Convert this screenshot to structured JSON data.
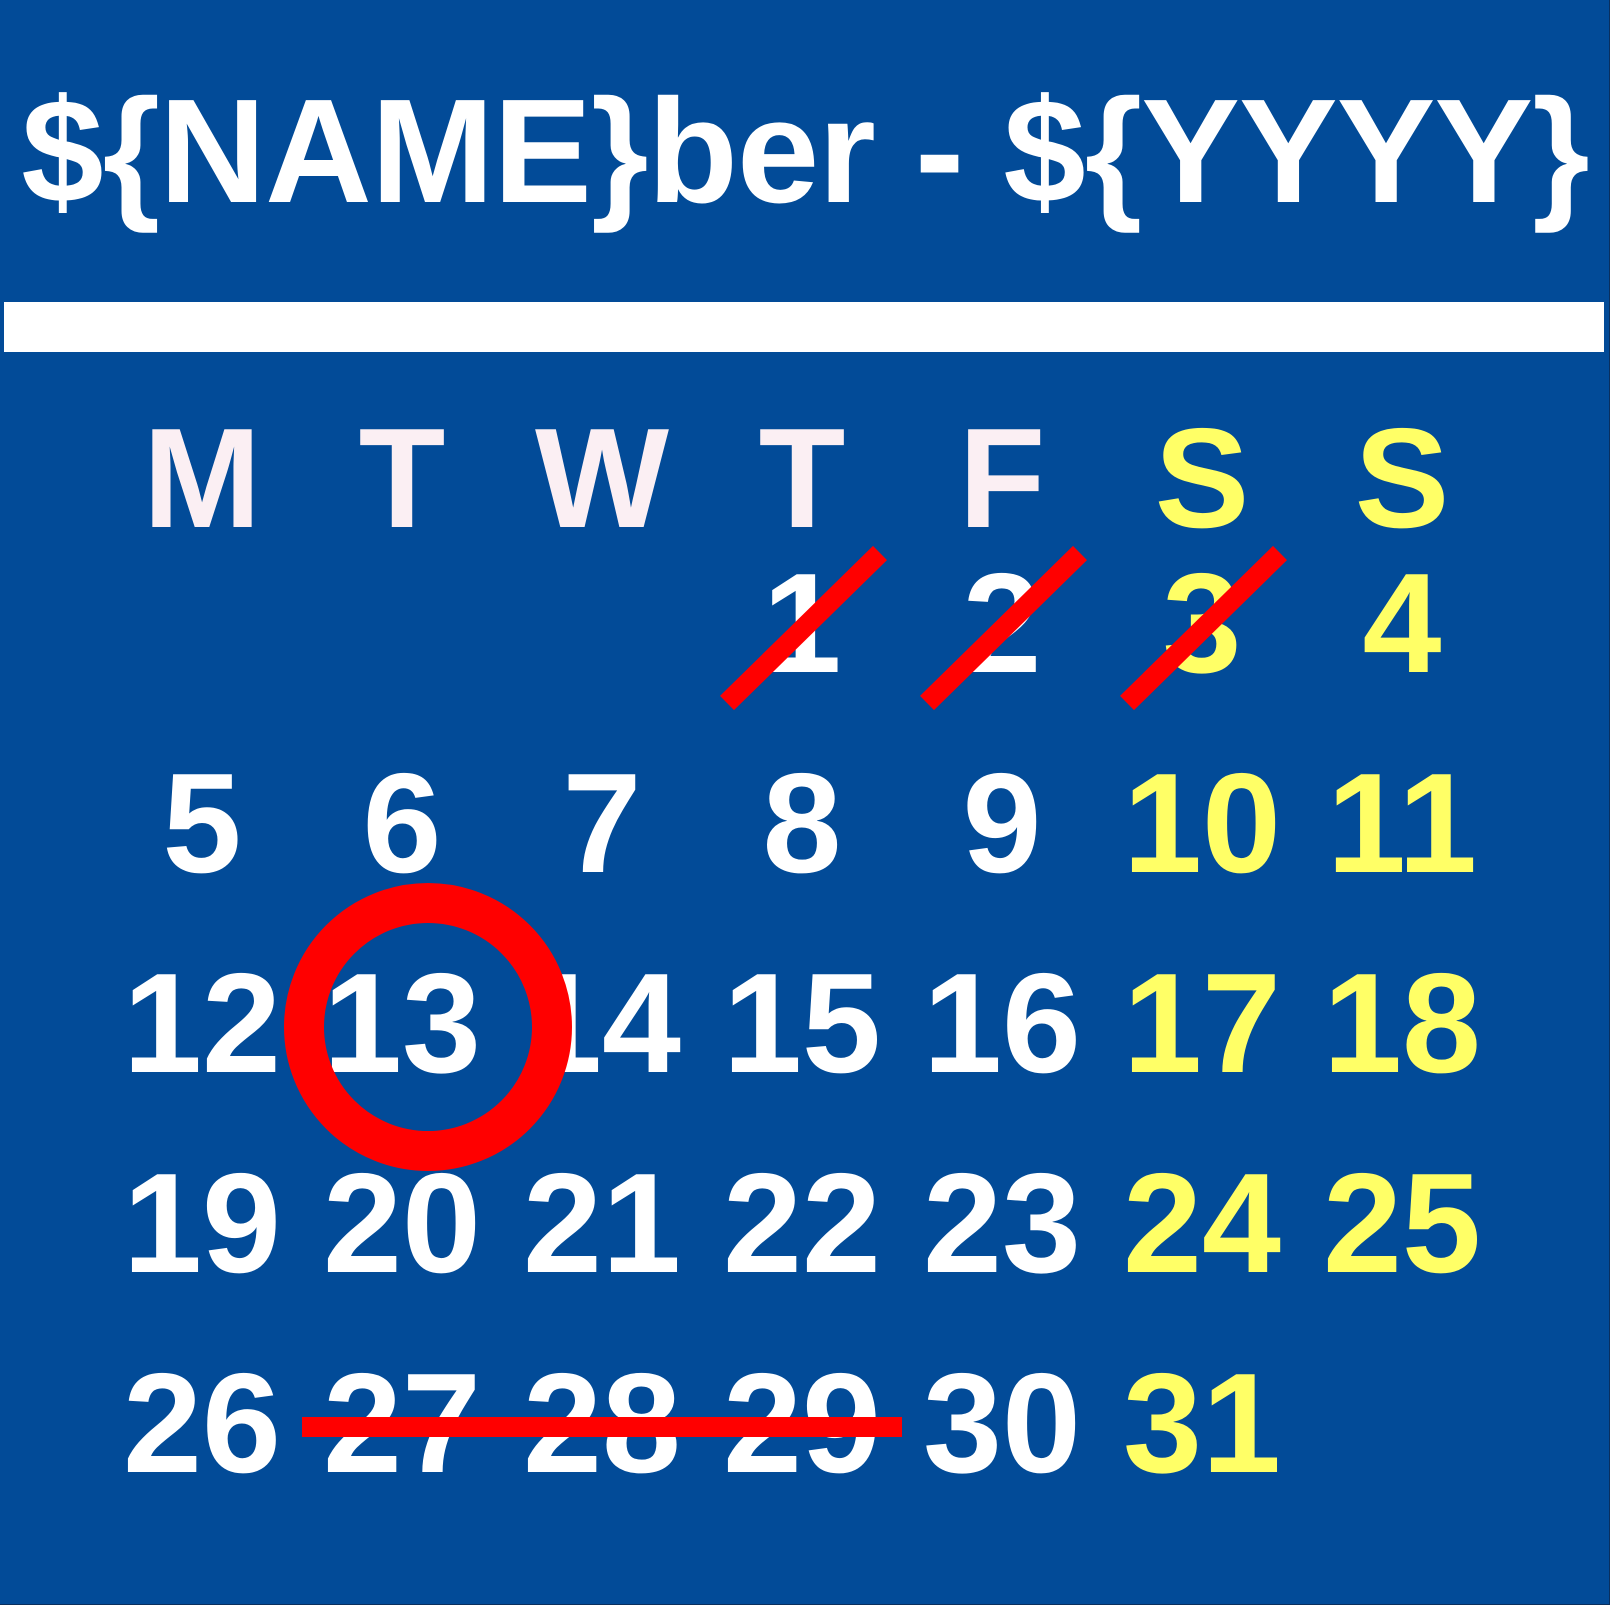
{
  "title": "${NAME}ber - ${YYYY}",
  "colors": {
    "background": "#024b98",
    "weekday_text": "#fbeff3",
    "weekday_number": "#ffffff",
    "weekend": "#ffff66",
    "mark": "#ff0000",
    "divider": "#ffffff"
  },
  "weekdays": [
    "M",
    "T",
    "W",
    "T",
    "F",
    "S",
    "S"
  ],
  "weeks": [
    [
      "",
      "",
      "",
      "1",
      "2",
      "3",
      "4"
    ],
    [
      "5",
      "6",
      "7",
      "8",
      "9",
      "10",
      "11"
    ],
    [
      "12",
      "13",
      "14",
      "15",
      "16",
      "17",
      "18"
    ],
    [
      "19",
      "20",
      "21",
      "22",
      "23",
      "24",
      "25"
    ],
    [
      "26",
      "27",
      "28",
      "29",
      "30",
      "31",
      ""
    ]
  ],
  "crossed_out_days": [
    "1",
    "2",
    "3"
  ],
  "struck_through_days": [
    "27",
    "28",
    "29"
  ],
  "circled_day": "13"
}
